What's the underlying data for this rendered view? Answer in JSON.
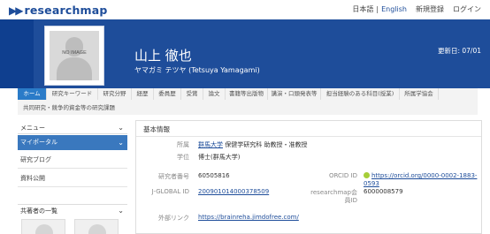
{
  "header": {
    "logo_text": "researchmap",
    "lang_ja": "日本語",
    "lang_sep": "|",
    "lang_en": "English",
    "register": "新規登録",
    "login": "ログイン"
  },
  "profile": {
    "name": "山上 徹也",
    "reading": "ヤマガミ テツヤ (Tetsuya Yamagami)",
    "updated": "更新日: 07/01",
    "photo_placeholder": "NO IMAGE"
  },
  "tabs_row1": [
    "ホーム",
    "研究キーワード",
    "研究分野",
    "経歴",
    "委員歴",
    "受賞",
    "論文",
    "書籍等出版物",
    "講演・口頭発表等",
    "担当経験のある科目(授業)",
    "所属学協会"
  ],
  "tabs_row2": [
    "共同研究・競争的資金等の研究課題"
  ],
  "sidebar": {
    "menu": "メニュー",
    "portal": "マイポータル",
    "items": [
      "研究ブログ",
      "資料公開"
    ],
    "coauthors": "共著者の一覧"
  },
  "basic": {
    "title": "基本情報",
    "affiliation_label": "所属",
    "affiliation_univ": "群馬大学",
    "affiliation_rest": " 保健学研究科 助教授・准教授",
    "degree_label": "学位",
    "degree_value": "博士(群馬大学)",
    "researcher_no_label": "研究者番号",
    "researcher_no": "60505816",
    "jglobal_label": "J-GLOBAL ID",
    "jglobal_id": "200901014000378509",
    "orcid_label": "ORCID ID",
    "orcid_url_1": "https://orcid.org/0000-0002-1883-",
    "orcid_url_2": "0593",
    "rm_id_label_1": "researchmap会",
    "rm_id_label_2": "員ID",
    "rm_id": "6000008579",
    "external_label": "外部リンク",
    "external_url": "https://brainreha.jimdofree.com/"
  },
  "colors": {
    "brand": "#1e4d9a",
    "active_tab": "#2a7bc8",
    "sidebar_active": "#3a78be",
    "orcid": "#a6ce39"
  },
  "icons": [
    "chevron-down-icon",
    "orcid-icon",
    "placeholder-avatar-icon"
  ]
}
